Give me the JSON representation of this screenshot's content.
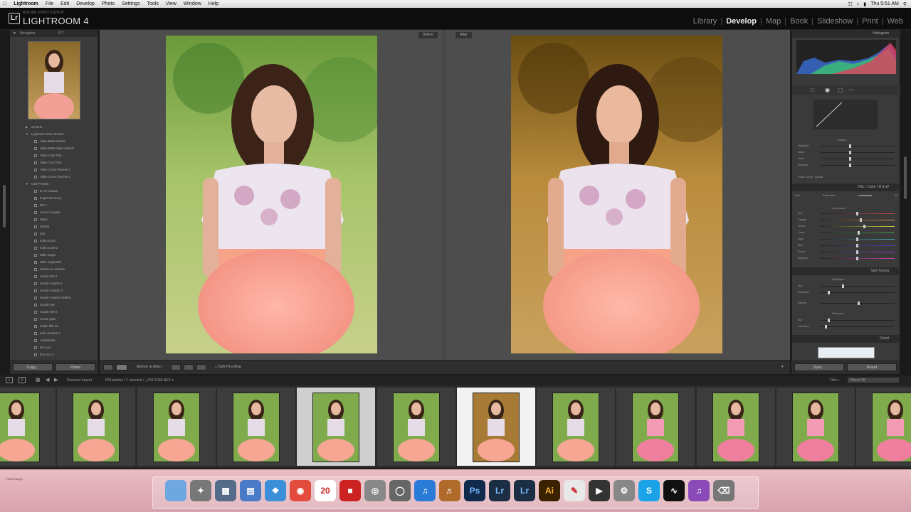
{
  "menubar": {
    "items": [
      "Lightroom",
      "File",
      "Edit",
      "Develop",
      "Photo",
      "Settings",
      "Tools",
      "View",
      "Window",
      "Help"
    ],
    "clock": "Thu 5:51 AM"
  },
  "app": {
    "brand_small": "ADOBE PHOTOSHOP",
    "brand": "LIGHTROOM 4",
    "modules": [
      "Library",
      "Develop",
      "Map",
      "Book",
      "Slideshow",
      "Print",
      "Web"
    ],
    "active_module": "Develop"
  },
  "left_panel": {
    "navigator_title": "Navigator",
    "nav_zoom": "FIT",
    "presets_heading": "General",
    "preset_groups": [
      {
        "name": "Lightroom Video Presets",
        "items": [
          "Video B&W Classic",
          "Video B&W High Contrast",
          "Video Color Pop",
          "Video Cool Tone",
          "Video Cross Process 1",
          "Video Cross Process 2"
        ]
      },
      {
        "name": "User Presets",
        "items": [
          "B FIX Clouds",
          "B special Heavy",
          "BW 1",
          "Accent Lingalia",
          "Blue2",
          "DOWN",
          "DSL",
          "edite at soft",
          "edite at soft 2",
          "Edite magia",
          "Edite magia BW",
          "Koosts em defeore",
          "Koosle BW 2",
          "Koosle Knastre 1",
          "Koosle Knastre 3",
          "Koosle Knastre Healthy",
          "Koosle BW",
          "Koosle BW 2",
          "Komte gods",
          "Kuslin fold sor",
          "Kolin Koustre 2",
          "Lobsolladas",
          "M m xxx",
          "M m xxx 2"
        ]
      }
    ],
    "copy_label": "Copy...",
    "paste_label": "Paste"
  },
  "center": {
    "before_label": "Before",
    "after_label": "After",
    "toolbar": {
      "view_label": "Before & After :",
      "proof_label": "Soft Proofing"
    }
  },
  "right_panel": {
    "histogram_title": "Histogram",
    "region_title": "Region",
    "region_sliders": [
      "Highlights",
      "Lights",
      "Darks",
      "Shadows"
    ],
    "point_curve_label": "Point Curve :",
    "point_curve_value": "Linear",
    "hsl_tabs": [
      "HSL",
      "Color",
      "B & W"
    ],
    "hsl_subtabs": [
      "Hue",
      "Saturation",
      "Luminance",
      "All"
    ],
    "hsl_active": "Luminance",
    "hsl_section": "Luminance",
    "hsl_sliders": [
      {
        "label": "Red",
        "value": 0.5
      },
      {
        "label": "Orange",
        "value": 0.55
      },
      {
        "label": "Yellow",
        "value": 0.6
      },
      {
        "label": "Green",
        "value": 0.52
      },
      {
        "label": "Aqua",
        "value": 0.5
      },
      {
        "label": "Blue",
        "value": 0.5
      },
      {
        "label": "Purple",
        "value": 0.5
      },
      {
        "label": "Magenta",
        "value": 0.5
      }
    ],
    "split_toning_title": "Split Toning",
    "split_highlights": "Highlights",
    "split_shadows": "Shadows",
    "split_sliders": [
      "Hue",
      "Saturation",
      "Balance",
      "Hue",
      "Saturation"
    ],
    "detail_title": "Detail",
    "sync_label": "Sync...",
    "reset_label": "Reset"
  },
  "filmstrip": {
    "source": "Previous Import",
    "info": "878 photos / 1 selected / _DSC1099.NEF ▾",
    "filter_label": "Filter :",
    "filter_value": "Filters Off",
    "count": 12,
    "selected_index": 4,
    "active_index": 6
  },
  "dock": {
    "label": "Fotocharger",
    "apps": [
      "Finder",
      "Launchpad",
      "Utilities",
      "Preview",
      "Safari",
      "Chrome",
      "Calendar",
      "PhotoBooth",
      "Network",
      "Time Machine",
      "iTunes",
      "Guitar",
      "Photoshop",
      "Lightroom",
      "Lightroom",
      "Illustrator",
      "Pages",
      "Final Cut",
      "Utility",
      "Skype",
      "Activity Monitor",
      "iTunes2",
      "Trash"
    ],
    "calendar_date": "20"
  },
  "colors": {
    "accent": "#dddddd",
    "panel": "#3a3a3a",
    "dock": "#e0b0b9"
  }
}
